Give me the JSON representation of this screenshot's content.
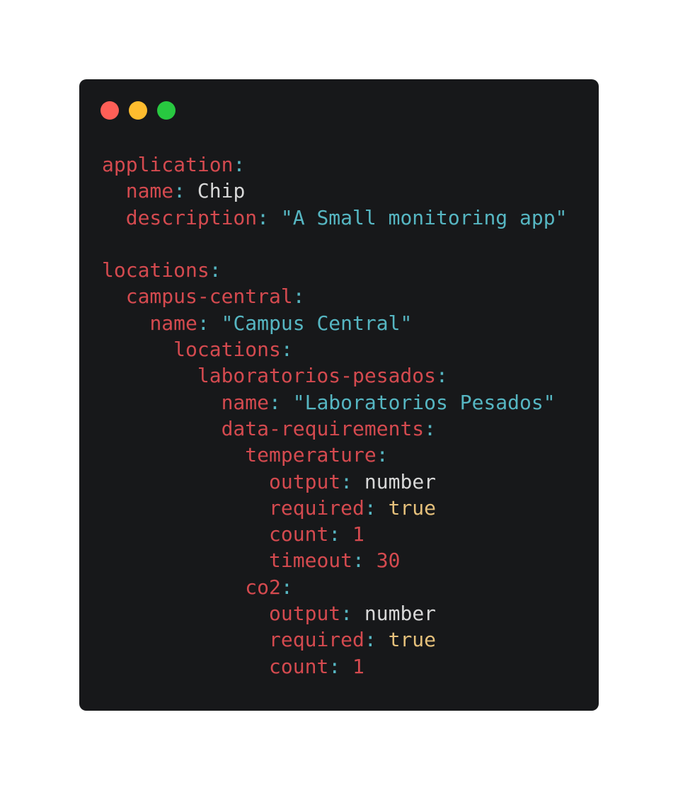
{
  "window": {
    "controls": [
      {
        "name": "close",
        "color": "#fe5f57"
      },
      {
        "name": "minimize",
        "color": "#febc2e"
      },
      {
        "name": "maximize",
        "color": "#28c840"
      }
    ]
  },
  "code": {
    "lines": [
      {
        "indent": 0,
        "key": "application",
        "value": "",
        "type": "none"
      },
      {
        "indent": 1,
        "key": "name",
        "value": "Chip",
        "type": "plain"
      },
      {
        "indent": 1,
        "key": "description",
        "value": "\"A Small monitoring app\"",
        "type": "str"
      },
      {
        "indent": 0,
        "key": "",
        "value": "",
        "type": "blank"
      },
      {
        "indent": 0,
        "key": "locations",
        "value": "",
        "type": "none"
      },
      {
        "indent": 1,
        "key": "campus-central",
        "value": "",
        "type": "none"
      },
      {
        "indent": 2,
        "key": "name",
        "value": "\"Campus Central\"",
        "type": "str"
      },
      {
        "indent": 3,
        "key": "locations",
        "value": "",
        "type": "none"
      },
      {
        "indent": 4,
        "key": "laboratorios-pesados",
        "value": "",
        "type": "none"
      },
      {
        "indent": 5,
        "key": "name",
        "value": "\"Laboratorios Pesados\"",
        "type": "str"
      },
      {
        "indent": 5,
        "key": "data-requirements",
        "value": "",
        "type": "none"
      },
      {
        "indent": 6,
        "key": "temperature",
        "value": "",
        "type": "none"
      },
      {
        "indent": 7,
        "key": "output",
        "value": "number",
        "type": "plain"
      },
      {
        "indent": 7,
        "key": "required",
        "value": "true",
        "type": "bool"
      },
      {
        "indent": 7,
        "key": "count",
        "value": "1",
        "type": "num"
      },
      {
        "indent": 7,
        "key": "timeout",
        "value": "30",
        "type": "num"
      },
      {
        "indent": 6,
        "key": "co2",
        "value": "",
        "type": "none"
      },
      {
        "indent": 7,
        "key": "output",
        "value": "number",
        "type": "plain"
      },
      {
        "indent": 7,
        "key": "required",
        "value": "true",
        "type": "bool"
      },
      {
        "indent": 7,
        "key": "count",
        "value": "1",
        "type": "num"
      }
    ]
  },
  "colors": {
    "background": "#17181a",
    "key": "#d44a4f",
    "punctuation": "#56b6c2",
    "string": "#56b6c2",
    "boolean": "#e5c07b",
    "plain": "#d8d8d8"
  }
}
